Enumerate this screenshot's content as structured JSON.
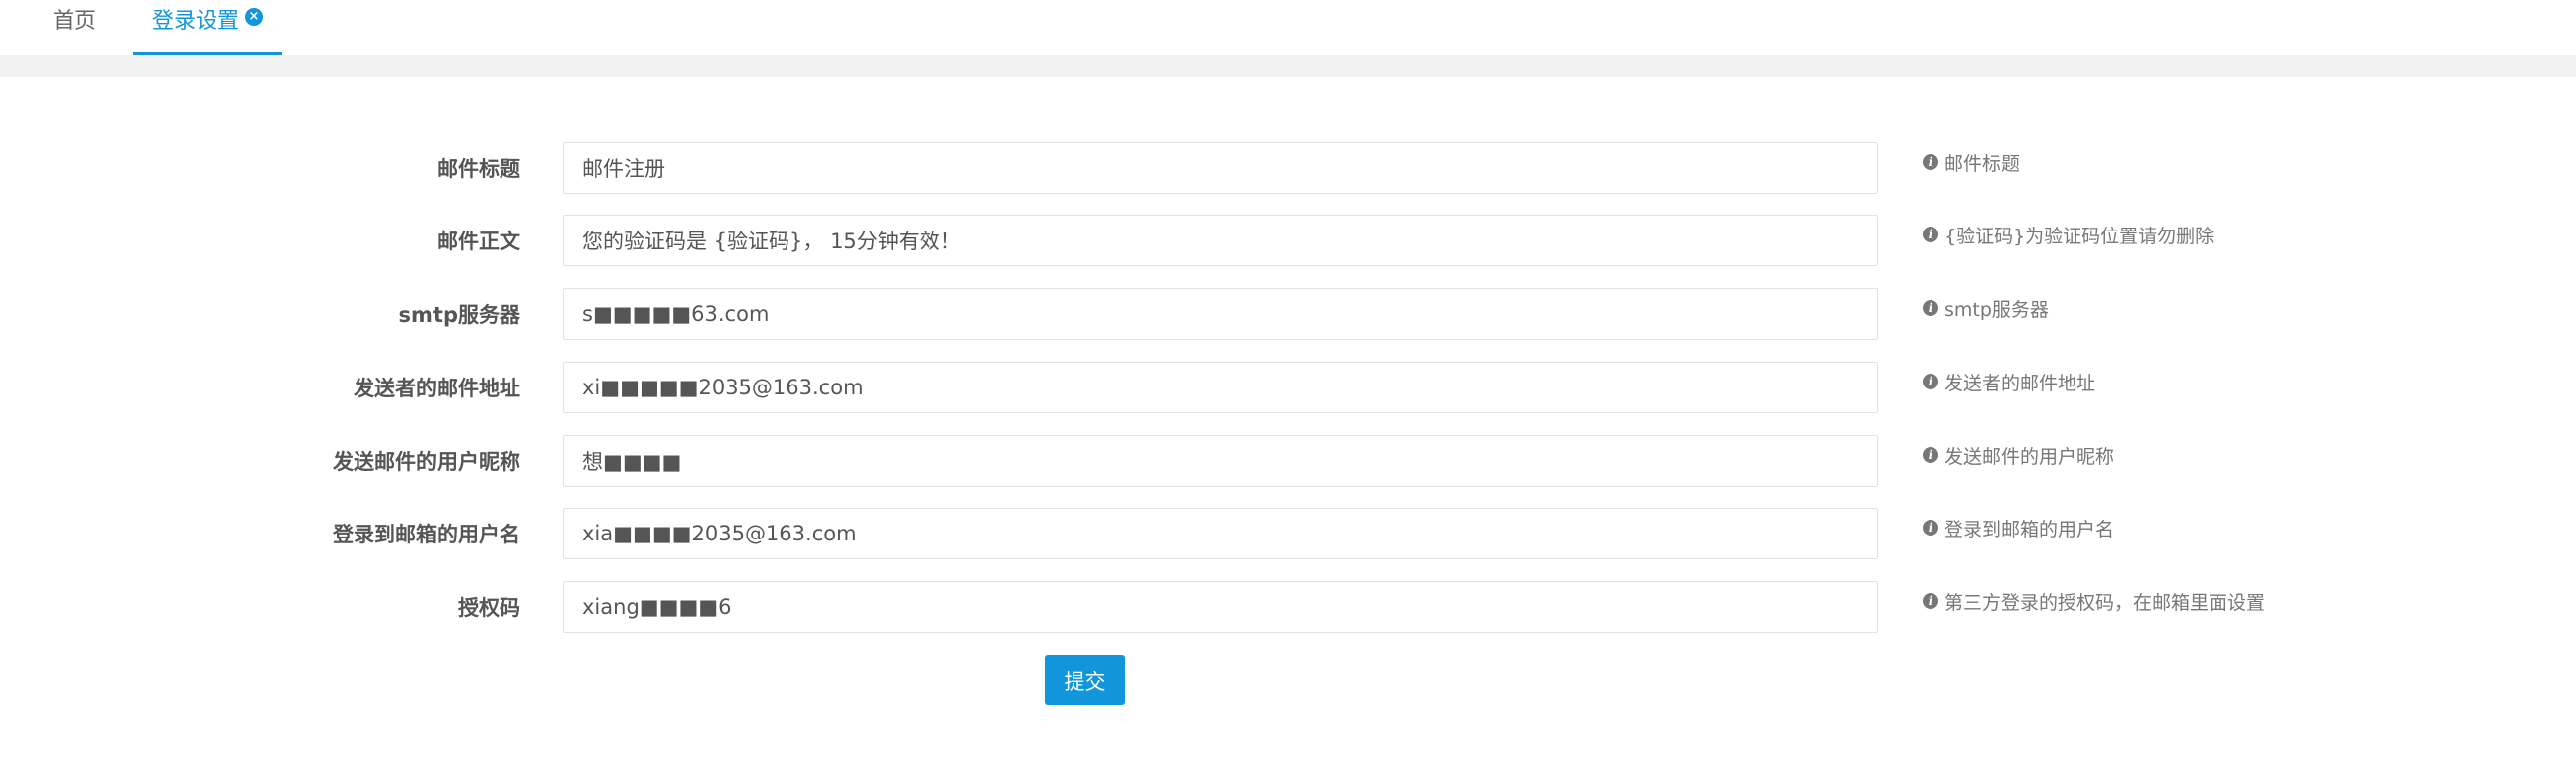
{
  "tabs": {
    "home": "首页",
    "login_settings": "登录设置",
    "close_glyph": "×"
  },
  "colors": {
    "accent": "#1296db",
    "label": "#555555",
    "help": "#777777",
    "border": "#e2e2e2",
    "strip": "#f2f2f2"
  },
  "form": {
    "fields": [
      {
        "label": "邮件标题",
        "value": "邮件注册",
        "help": "邮件标题"
      },
      {
        "label": "邮件正文",
        "value": "您的验证码是 {验证码}， 15分钟有效！",
        "help": "{验证码}为验证码位置请勿删除"
      },
      {
        "label": "smtp服务器",
        "value": "s■■■■■63.com",
        "help": "smtp服务器"
      },
      {
        "label": "发送者的邮件地址",
        "value": "xi■■■■■2035@163.com",
        "help": "发送者的邮件地址"
      },
      {
        "label": "发送邮件的用户昵称",
        "value": "想■■■■",
        "help": "发送邮件的用户昵称"
      },
      {
        "label": "登录到邮箱的用户名",
        "value": "xia■■■■2035@163.com",
        "help": "登录到邮箱的用户名"
      },
      {
        "label": "授权码",
        "value": "xiang■■■■6",
        "help": "第三方登录的授权码，在邮箱里面设置"
      }
    ],
    "info_icon_glyph": "i",
    "submit_label": "提交"
  }
}
